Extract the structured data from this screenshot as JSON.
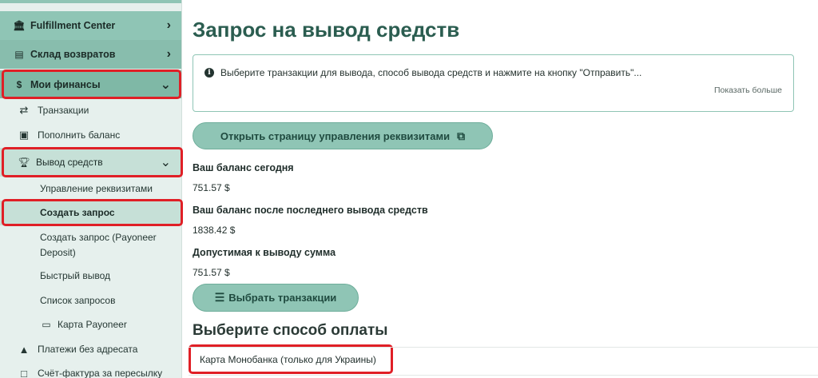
{
  "sidebar": {
    "fulfillment": "Fulfillment Center",
    "returns": "Склад возвратов",
    "finances": "Мои финансы",
    "transactions": "Транзакции",
    "topup": "Пополнить баланс",
    "withdraw": "Вывод средств",
    "manage_req": "Управление реквизитами",
    "create_req": "Создать запрос",
    "create_payoneer_1": "Создать запрос (Payoneer",
    "create_payoneer_2": "Deposit)",
    "quick": "Быстрый вывод",
    "requests": "Список запросов",
    "payoneer_card": "Карта Payoneer",
    "unaddressed": "Платежи без адресата",
    "invoice": "Счёт-фактура за пересылку"
  },
  "main": {
    "title": "Запрос на вывод средств",
    "info_text": "Выберите транзакции для вывода, способ вывода средств и нажмите на кнопку \"Отправить\"...",
    "show_more": "Показать больше",
    "open_req_button": "Открыть страницу управления реквизитами",
    "balance_today_label": "Ваш баланс сегодня",
    "balance_today_value": "751.57 $",
    "balance_after_label": "Ваш баланс после последнего вывода средств",
    "balance_after_value": "1838.42 $",
    "allowed_label": "Допустимая к выводу сумма",
    "allowed_value": "751.57 $",
    "select_tx_button": "Выбрать транзакции",
    "pay_title": "Выберите способ оплаты",
    "pay_option": "Карта Монобанка (только для Украины)"
  },
  "colors": {
    "accent": "#8fc5b5",
    "highlight": "#e01f26",
    "title": "#2b5d50"
  }
}
